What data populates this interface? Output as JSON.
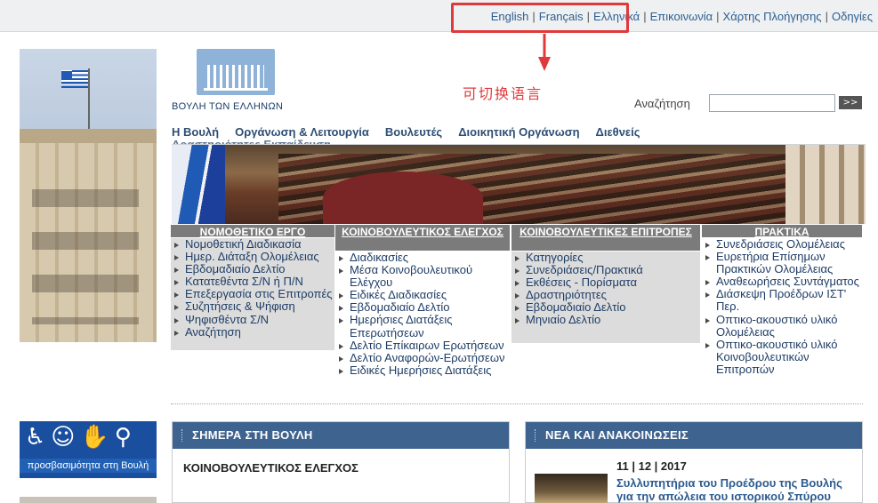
{
  "top_links": {
    "english": "English",
    "french": "Français",
    "greek": "Ελληνικά",
    "contact": "Επικοινωνία",
    "sitemap": "Χάρτης Πλοήγησης",
    "guides": "Οδηγίες"
  },
  "annotation": {
    "text": "可切换语言",
    "color": "#e0393c"
  },
  "logo": {
    "name": "ΒΟΥΛΗ ΤΩΝ ΕΛΛΗΝΩΝ"
  },
  "search": {
    "label": "Αναζήτηση",
    "value": "",
    "button": ">>"
  },
  "nav": {
    "items": [
      "Η Βουλή",
      "Οργάνωση & Λειτουργία",
      "Βουλευτές",
      "Διοικητική Οργάνωση",
      "Διεθνείς"
    ],
    "hidden_row": "Δραστηριότητες Εκπαίδευση"
  },
  "columns": [
    {
      "title": "ΝΟΜΟΘΕΤΙΚΟ ΕΡΓΟ",
      "items": [
        "Νομοθετική Διαδικασία",
        "Ημερ. Διάταξη Ολομέλειας",
        "Εβδομαδιαίο Δελτίο",
        "Κατατεθέντα Σ/Ν ή Π/Ν",
        "Επεξεργασία στις Επιτροπές",
        "Συζητήσεις & Ψήφιση",
        "Ψηφισθέντα Σ/Ν",
        "Αναζήτηση"
      ]
    },
    {
      "title": "ΚΟΙΝΟΒΟΥΛΕΥΤΙΚΟΣ ΕΛΕΓΧΟΣ",
      "items": [
        "Διαδικασίες",
        "Μέσα Κοινοβουλευτικού Ελέγχου",
        "Ειδικές Διαδικασίες",
        "Εβδομαδιαίο Δελτίο",
        "Ημερήσιες Διατάξεις Επερωτήσεων",
        "Δελτίο Επίκαιρων Ερωτήσεων",
        "Δελτίο Αναφορών-Ερωτήσεων",
        "Ειδικές Ημερήσιες Διατάξεις"
      ]
    },
    {
      "title": "ΚΟΙΝΟΒΟΥΛΕΥΤΙΚΕΣ ΕΠΙΤΡΟΠΕΣ",
      "items": [
        "Κατηγορίες",
        "Συνεδριάσεις/Πρακτικά",
        "Εκθέσεις - Πορίσματα",
        "Δραστηριότητες",
        "Εβδομαδιαίο Δελτίο",
        "Μηνιαίο Δελτίο"
      ]
    },
    {
      "title": "ΠΡΑΚΤΙΚΑ",
      "items": [
        "Συνεδριάσεις Ολομέλειας",
        "Ευρετήρια Επίσημων Πρακτικών Ολομέλειας",
        "Αναθεωρήσεις Συντάγματος",
        "Διάσκεψη Προέδρων ΙΣΤ' Περ.",
        "Οπτικο-ακουστικό υλικό Ολομέλειας",
        "Οπτικο-ακουστικό υλικό Κοινοβουλευτικών Επιτροπών"
      ]
    }
  ],
  "accessibility": {
    "label": "προσβασιμότητα στη Βουλή"
  },
  "today_panel": {
    "title": "ΣΗΜΕΡΑ ΣΤΗ ΒΟΥΛΗ",
    "subtitle": "ΚΟΙΝΟΒΟΥΛΕΥΤΙΚΟΣ ΕΛΕΓΧΟΣ"
  },
  "news_panel": {
    "title": "ΝΕΑ ΚΑΙ ΑΝΑΚΟΙΝΩΣΕΙΣ",
    "date": "11 | 12 | 2017",
    "headline": "Συλλυπητήρια του Προέδρου της Βουλής για την απώλεια του ιστορικού Σπύρου"
  },
  "colors": {
    "link_blue": "#2d5f92",
    "panel_header": "#3e638f",
    "column_header": "#7b7b7b",
    "highlight_red": "#e0393c"
  }
}
